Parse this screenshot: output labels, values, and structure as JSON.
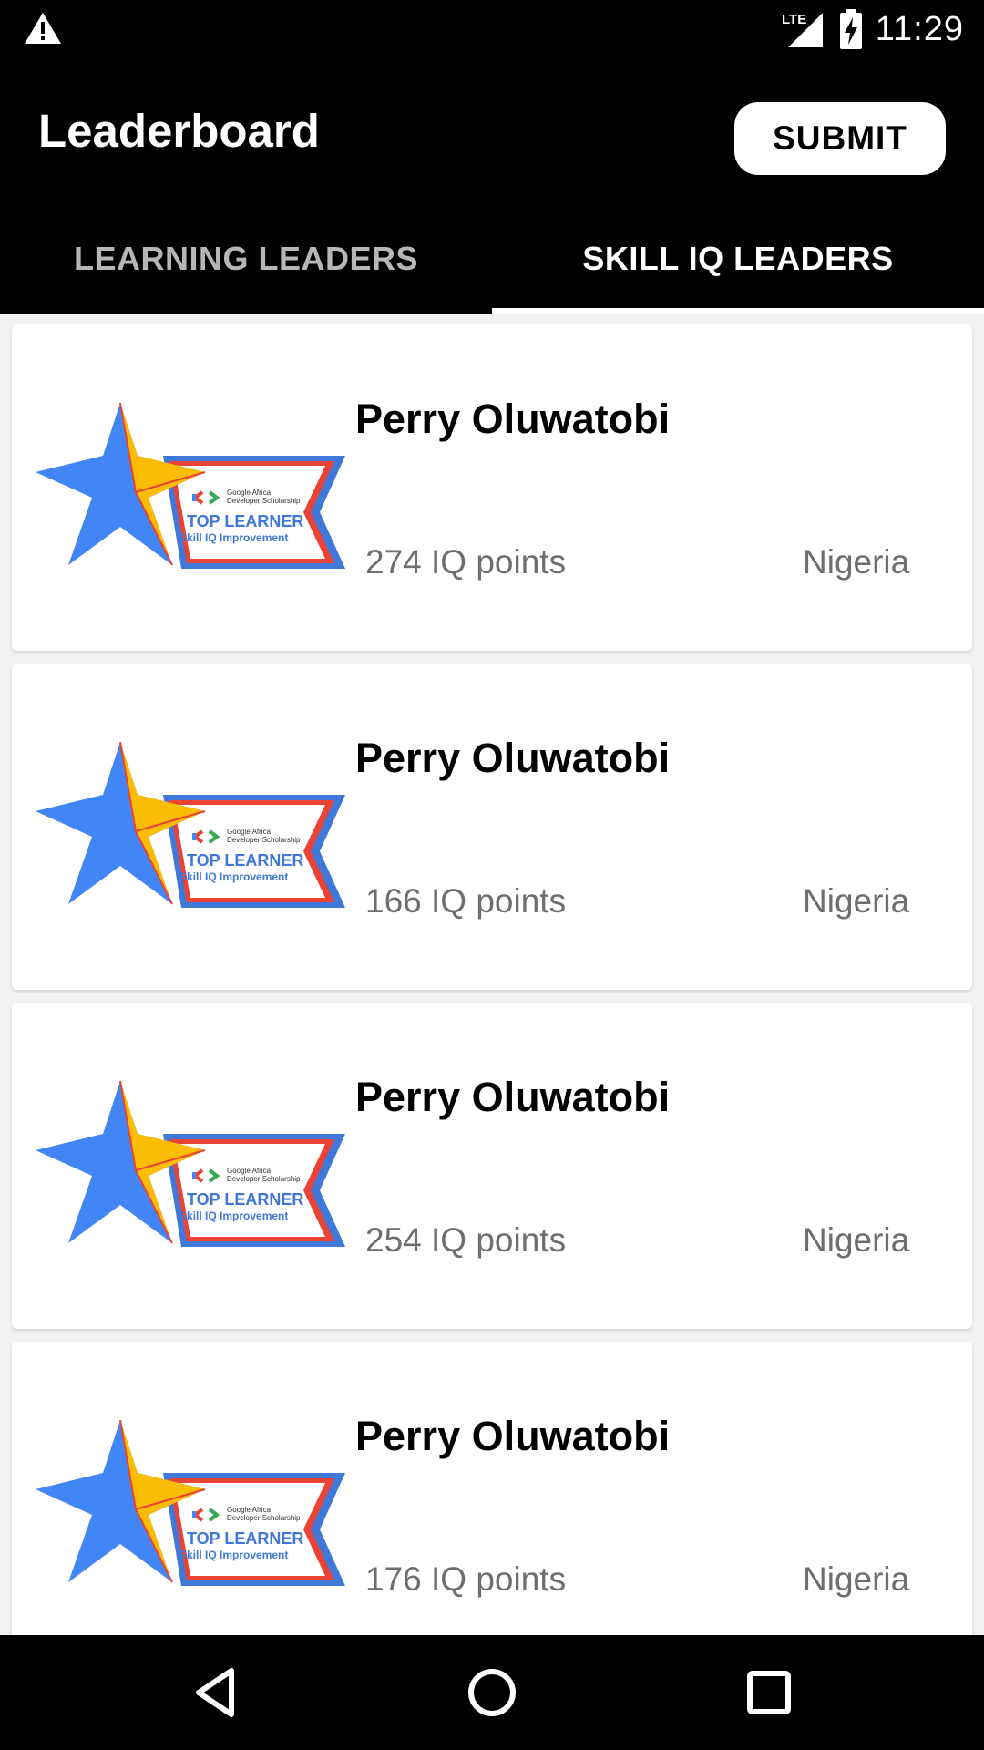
{
  "status_bar": {
    "time": "11:29",
    "network_label": "LTE",
    "icons": [
      "warning-icon",
      "signal-icon",
      "battery-charging-icon"
    ]
  },
  "app_bar": {
    "title": "Leaderboard",
    "submit_label": "SUBMIT"
  },
  "tabs": [
    {
      "label": "LEARNING LEADERS",
      "active": false
    },
    {
      "label": "SKILL IQ LEADERS",
      "active": true
    }
  ],
  "badge": {
    "org_line1": "Google Africa",
    "org_line2": "Developer Scholarship",
    "title": "TOP LEARNER",
    "subtitle": "Skill IQ Improvement"
  },
  "leaders": [
    {
      "name": "Perry Oluwatobi",
      "score": "274 IQ points",
      "country": "Nigeria"
    },
    {
      "name": "Perry Oluwatobi",
      "score": "166 IQ points",
      "country": "Nigeria"
    },
    {
      "name": "Perry Oluwatobi",
      "score": "254 IQ points",
      "country": "Nigeria"
    },
    {
      "name": "Perry Oluwatobi",
      "score": "176 IQ points",
      "country": "Nigeria"
    }
  ],
  "nav_bar": {
    "icons": [
      "back-icon",
      "home-icon",
      "recents-icon"
    ]
  },
  "colors": {
    "app_bar": "#000000",
    "star_blue": "#4285f4",
    "star_yellow": "#fbbc04",
    "badge_red": "#ea4335",
    "badge_green": "#34a853",
    "secondary_text": "#6e6e6e"
  }
}
